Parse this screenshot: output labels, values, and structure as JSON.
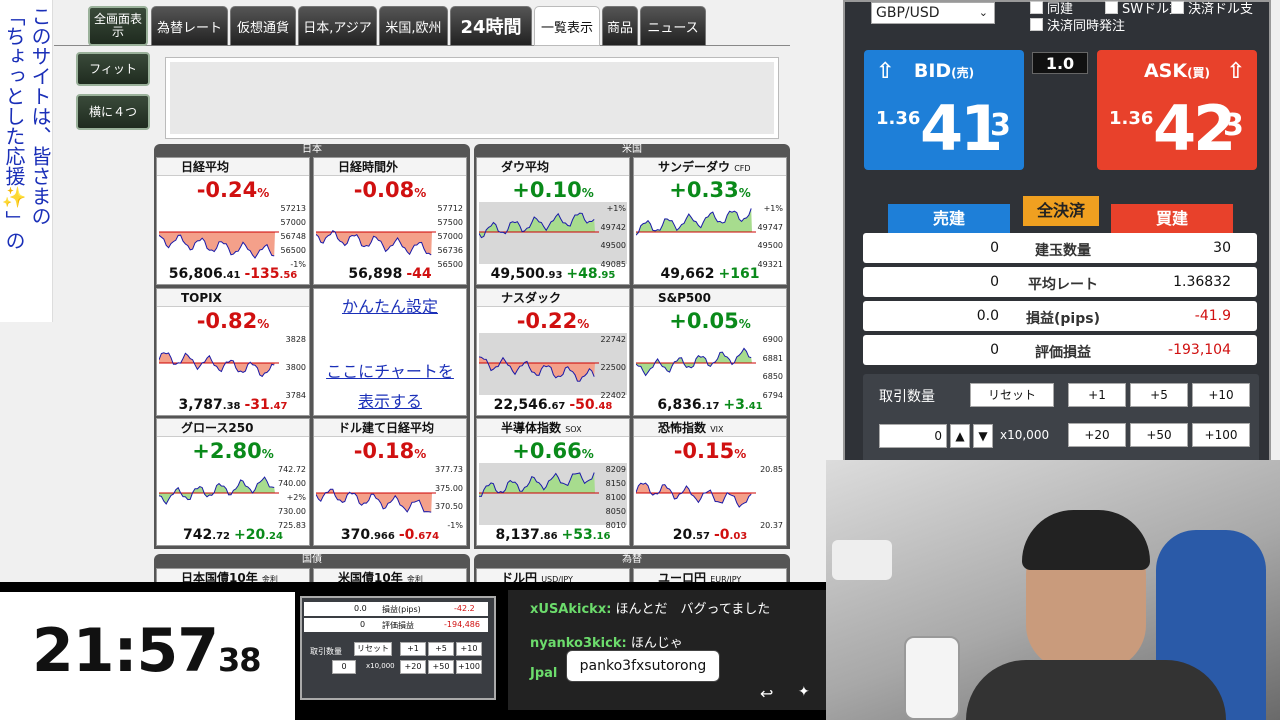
{
  "banner": {
    "col1": "このサイトは、皆さまの",
    "col2": "「ちょっとした応援✨」の"
  },
  "left_buttons": {
    "fullscreen": "全画面表示",
    "fit": "フィット",
    "four": "横に４つ"
  },
  "tabs": [
    {
      "label": "為替レート"
    },
    {
      "label": "仮想通貨"
    },
    {
      "label": "日本,アジア"
    },
    {
      "label": "米国,欧州"
    },
    {
      "label": "24時間"
    },
    {
      "label": "一覧表示"
    },
    {
      "label": "商品"
    },
    {
      "label": "ニュース"
    }
  ],
  "sections": {
    "japan": "日本",
    "us": "米国",
    "bonds": "国債",
    "fx": "為替"
  },
  "cards": [
    {
      "name": "日経平均",
      "flag": "jp",
      "pct": "-0.24",
      "dir": "dn",
      "price": "56,806",
      "dec": ".41",
      "chg": "-135",
      "chgdec": ".56",
      "ylabels": [
        "57213",
        "57000",
        "56748",
        "56500",
        "-1%"
      ]
    },
    {
      "name": "日経時間外",
      "flag": "jp",
      "pct": "-0.08",
      "dir": "dn",
      "price": "56,898",
      "dec": "",
      "chg": "-44",
      "chgdec": "",
      "ylabels": [
        "57712",
        "57500",
        "57000",
        "56736",
        "56500"
      ]
    },
    {
      "name": "ダウ平均",
      "flag": "us",
      "pct": "+0.10",
      "dir": "up",
      "price": "49,500",
      "dec": ".93",
      "chg": "+48",
      "chgdec": ".95",
      "ylabels": [
        "+1%",
        "49742",
        "49500",
        "49085"
      ]
    },
    {
      "name": "サンデーダウ",
      "sub": "CFD",
      "flag": "us",
      "pct": "+0.33",
      "dir": "up",
      "price": "49,662",
      "dec": "",
      "chg": "+161",
      "chgdec": "",
      "ylabels": [
        "+1%",
        "49747",
        "49500",
        "49321"
      ]
    },
    {
      "name": "TOPIX",
      "flag": "jp",
      "pct": "-0.82",
      "dir": "dn",
      "price": "3,787",
      "dec": ".38",
      "chg": "-31",
      "chgdec": ".47",
      "ylabels": [
        "3828",
        "3800",
        "3784"
      ]
    },
    {
      "name": "ナスダック",
      "flag": "us",
      "pct": "-0.22",
      "dir": "dn",
      "price": "22,546",
      "dec": ".67",
      "chg": "-50",
      "chgdec": ".48",
      "ylabels": [
        "22742",
        "22500",
        "22402"
      ]
    },
    {
      "name": "S&P500",
      "flag": "us",
      "pct": "+0.05",
      "dir": "up",
      "price": "6,836",
      "dec": ".17",
      "chg": "+3",
      "chgdec": ".41",
      "ylabels": [
        "6900",
        "6881",
        "6850",
        "6794"
      ]
    },
    {
      "name": "グロース250",
      "flag": "jp",
      "pct": "+2.80",
      "dir": "up",
      "price": "742",
      "dec": ".72",
      "chg": "+20",
      "chgdec": ".24",
      "ylabels": [
        "742.72",
        "740.00",
        "+2%",
        "730.00",
        "725.83"
      ]
    },
    {
      "name": "ドル建て日経平均",
      "flag": "us",
      "pct": "-0.18",
      "dir": "dn",
      "price": "370",
      "dec": ".966",
      "chg": "-0",
      "chgdec": ".674",
      "ylabels": [
        "377.73",
        "375.00",
        "370.50",
        "-1%"
      ]
    },
    {
      "name": "半導体指数",
      "sub": "SOX",
      "flag": "us",
      "pct": "+0.66",
      "dir": "up",
      "price": "8,137",
      "dec": ".86",
      "chg": "+53",
      "chgdec": ".16",
      "ylabels": [
        "8209",
        "8150",
        "8100",
        "8050",
        "8010"
      ]
    },
    {
      "name": "恐怖指数",
      "sub": "VIX",
      "flag": "us",
      "pct": "-0.15",
      "dir": "dn",
      "price": "20",
      "dec": ".57",
      "chg": "-0",
      "chgdec": ".03",
      "ylabels": [
        "20.85",
        "20.37"
      ]
    }
  ],
  "setup_card": {
    "link1": "かんたん設定",
    "link2": "ここにチャートを表示する"
  },
  "bond_cards": [
    {
      "name": "日本国債10年",
      "sub": "金利"
    },
    {
      "name": "米国債10年",
      "sub": "金利"
    },
    {
      "name": "ドル円",
      "sub": "USD/JPY"
    },
    {
      "name": "ユーロ円",
      "sub": "EUR/JPY"
    }
  ],
  "trade": {
    "pair": "GBP/USD",
    "checkboxes": [
      "同建",
      "SWドル支",
      "決済ドル支",
      "決済同時発注"
    ],
    "bid": {
      "label": "BID",
      "sub": "(売)",
      "big": "1.36",
      "huge": "41",
      "sup": "3",
      "color": "#1e7fd8"
    },
    "ask": {
      "label": "ASK",
      "sub": "(買)",
      "big": "1.36",
      "huge": "42",
      "sup": "3",
      "color": "#e8412b"
    },
    "spread": "1.0",
    "sell_label": "売建",
    "close_all": "全決済",
    "buy_label": "買建",
    "rows": [
      {
        "left": "0",
        "mid": "建玉数量",
        "right": "30",
        "rcolor": "#111"
      },
      {
        "left": "0",
        "mid": "平均レート",
        "right": "1.36832",
        "rcolor": "#111"
      },
      {
        "left": "0.0",
        "mid": "損益(pips)",
        "right": "-41.9",
        "rcolor": "#d01010"
      },
      {
        "left": "0",
        "mid": "評価損益",
        "right": "-193,104",
        "rcolor": "#d01010"
      }
    ],
    "qty_label": "取引数量",
    "reset": "リセット",
    "plus1": "+1",
    "plus5": "+5",
    "plus10": "+10",
    "qty_value": "0",
    "multiplier": "x10,000",
    "plus20": "+20",
    "plus50": "+50",
    "plus100": "+100"
  },
  "clock": {
    "hm": "21:57",
    "s": "38"
  },
  "mini_panel": {
    "r1a": "0.0",
    "r1b": "損益(pips)",
    "r1c": "-42.2",
    "r2a": "0",
    "r2b": "評価損益",
    "r2c": "-194,486",
    "qty": "取引数量",
    "reset": "リセット",
    "b1": "+1",
    "b2": "+5",
    "b3": "+10",
    "val": "0",
    "mult": "x10,000",
    "b4": "+20",
    "b5": "+50",
    "b6": "+100"
  },
  "chat": [
    {
      "user": "xUSAkickx:",
      "text": "ほんとだ　バグってました"
    },
    {
      "user": "nyanko3kick:",
      "text": "ほんじゃ"
    },
    {
      "user": "Jpal",
      "text": ""
    }
  ],
  "tooltip": "panko3fxsutorong"
}
